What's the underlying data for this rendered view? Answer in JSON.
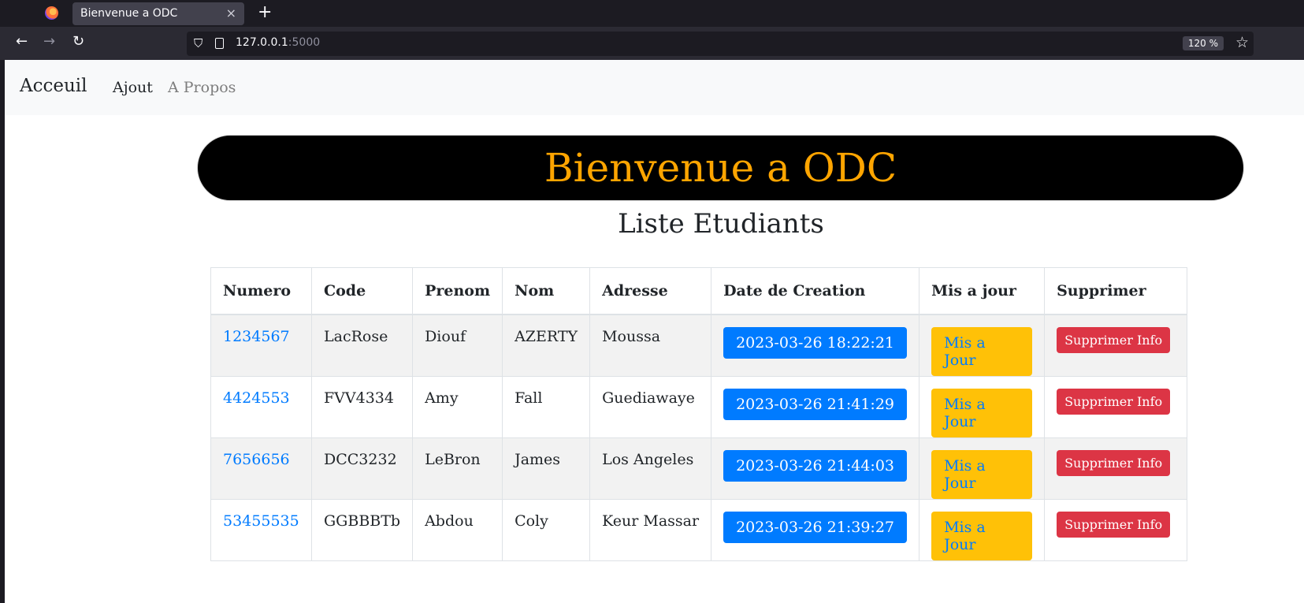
{
  "browser": {
    "tab_title": "Bienvenue a ODC",
    "tab_close": "×",
    "new_tab": "+",
    "url_host": "127.0.0.1",
    "url_port": ":5000",
    "zoom": "120 %"
  },
  "navbar": {
    "brand": "Acceuil",
    "links": [
      "Ajout",
      "A Propos"
    ]
  },
  "hero": {
    "title": "Bienvenue a ODC"
  },
  "list_title": "Liste Etudiants",
  "table": {
    "headers": [
      "Numero",
      "Code",
      "Prenom",
      "Nom",
      "Adresse",
      "Date de Creation",
      "Mis a jour",
      "Supprimer"
    ],
    "update_label": "Mis a Jour",
    "delete_label": "Supprimer Info",
    "rows": [
      {
        "numero": "1234567",
        "code": "LacRose",
        "prenom": "Diouf",
        "nom": "AZERTY",
        "adresse": "Moussa",
        "date": "2023-03-26 18:22:21"
      },
      {
        "numero": "4424553",
        "code": "FVV4334",
        "prenom": "Amy",
        "nom": "Fall",
        "adresse": "Guediawaye",
        "date": "2023-03-26 21:41:29"
      },
      {
        "numero": "7656656",
        "code": "DCC3232",
        "prenom": "LeBron",
        "nom": "James",
        "adresse": "Los Angeles",
        "date": "2023-03-26 21:44:03"
      },
      {
        "numero": "53455535",
        "code": "GGBBBTb",
        "prenom": "Abdou",
        "nom": "Coly",
        "adresse": "Keur Massar",
        "date": "2023-03-26 21:39:27"
      }
    ]
  },
  "colors": {
    "hero_bg": "#000000",
    "hero_text": "#ffa500",
    "primary": "#007bff",
    "warning": "#ffc107",
    "danger": "#dc3545"
  }
}
